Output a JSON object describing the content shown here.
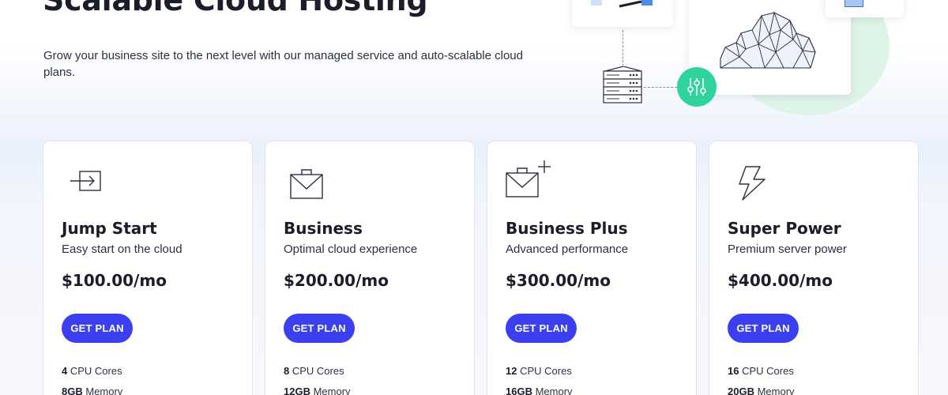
{
  "hero": {
    "title": "Scalable Cloud Hosting",
    "subtitle": "Grow your business site to the next level with our managed service and auto-scalable cloud plans."
  },
  "colors": {
    "primary_button": "#3b3ff0",
    "accent_green": "#2fd49c",
    "heading": "#1b1d2b"
  },
  "plans": [
    {
      "icon": "enter-arrow-icon",
      "name": "Jump Start",
      "description": "Easy start on the cloud",
      "price": "$100.00/mo",
      "button": "GET PLAN",
      "specs": [
        {
          "value": "4",
          "label": "CPU Cores"
        },
        {
          "value": "8GB",
          "label": "Memory"
        }
      ]
    },
    {
      "icon": "briefcase-envelope-icon",
      "name": "Business",
      "description": "Optimal cloud experience",
      "price": "$200.00/mo",
      "button": "GET PLAN",
      "specs": [
        {
          "value": "8",
          "label": "CPU Cores"
        },
        {
          "value": "12GB",
          "label": "Memory"
        }
      ]
    },
    {
      "icon": "briefcase-plus-icon",
      "name": "Business Plus",
      "description": "Advanced performance",
      "price": "$300.00/mo",
      "button": "GET PLAN",
      "specs": [
        {
          "value": "12",
          "label": "CPU Cores"
        },
        {
          "value": "16GB",
          "label": "Memory"
        }
      ]
    },
    {
      "icon": "lightning-icon",
      "name": "Super Power",
      "description": "Premium server power",
      "price": "$400.00/mo",
      "button": "GET PLAN",
      "specs": [
        {
          "value": "16",
          "label": "CPU Cores"
        },
        {
          "value": "20GB",
          "label": "Memory"
        }
      ]
    }
  ]
}
